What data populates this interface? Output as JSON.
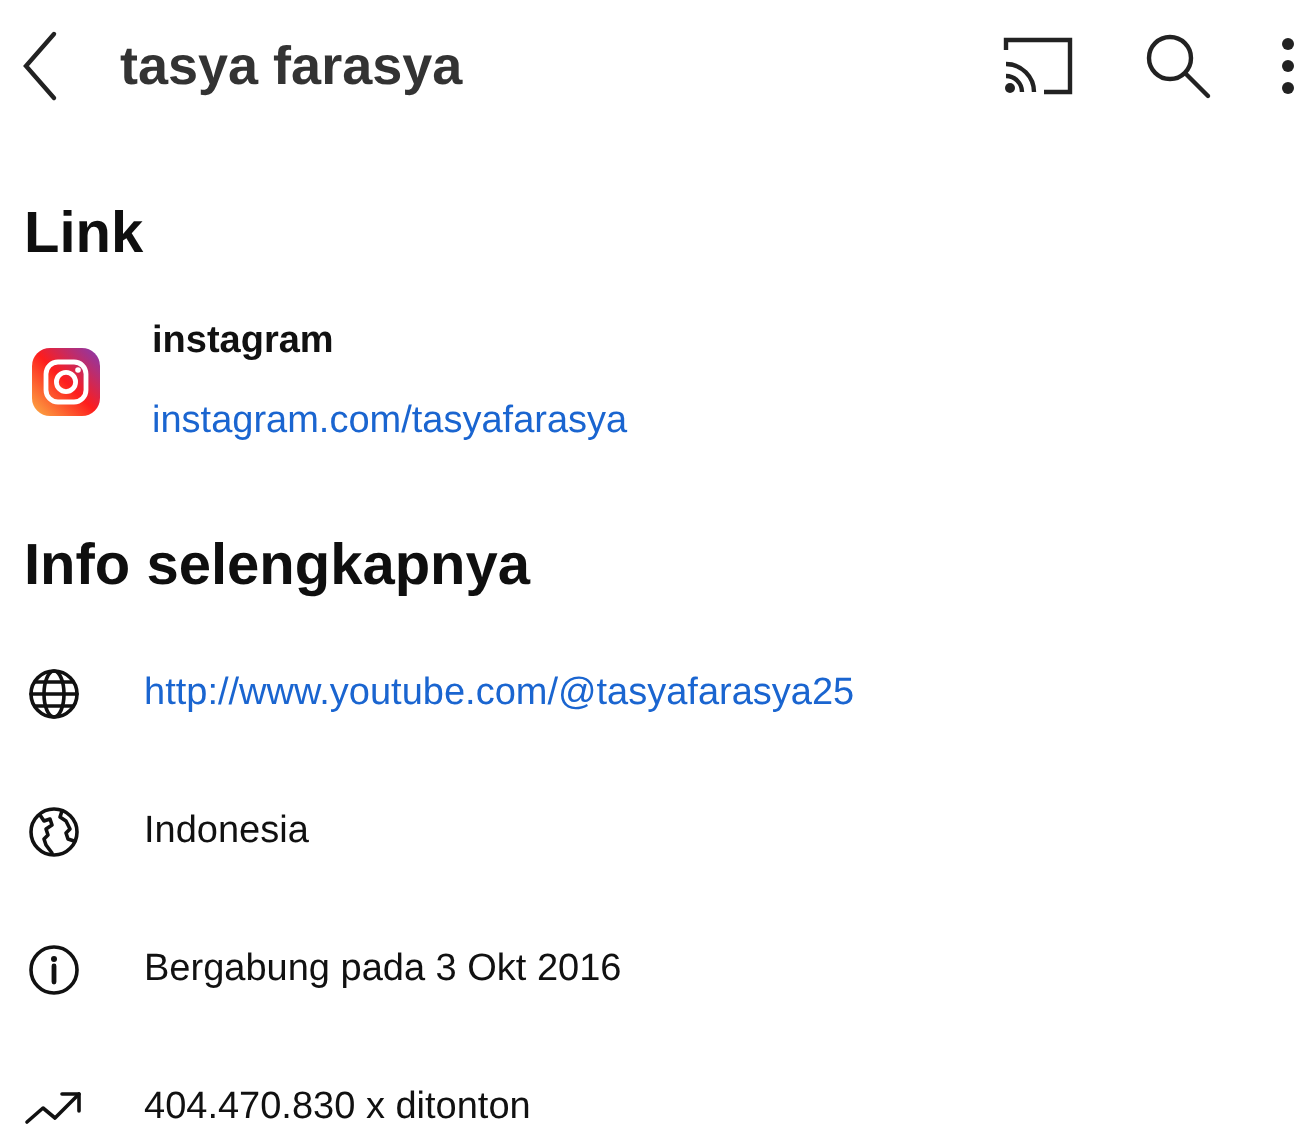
{
  "header": {
    "title": "tasya farasya"
  },
  "links_section": {
    "heading": "Link",
    "links": [
      {
        "name": "instagram",
        "url": "instagram.com/tasyafarasya"
      }
    ]
  },
  "info_section": {
    "heading": "Info selengkapnya",
    "rows": [
      {
        "kind": "website",
        "text": "http://www.youtube.com/@tasyafarasya25"
      },
      {
        "kind": "location",
        "text": "Indonesia"
      },
      {
        "kind": "joined",
        "text": "Bergabung pada 3 Okt 2016"
      },
      {
        "kind": "views",
        "text": "404.470.830 x ditonton"
      }
    ]
  }
}
